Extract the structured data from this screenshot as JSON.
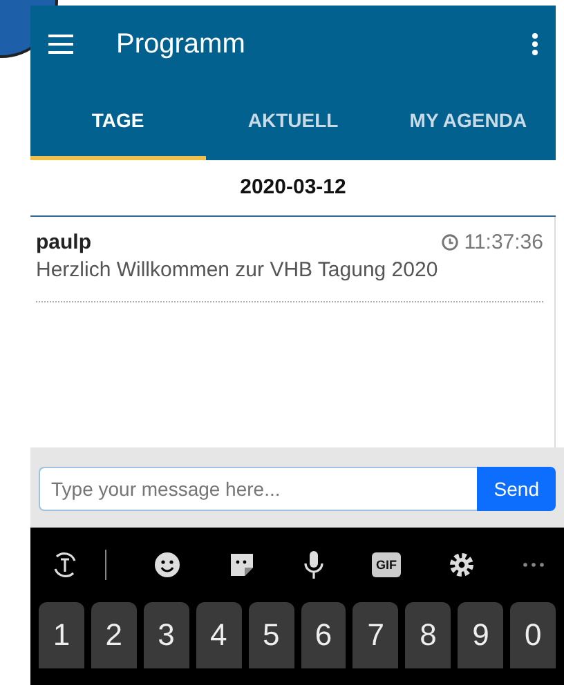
{
  "app_bar": {
    "title": "Programm"
  },
  "tabs": [
    {
      "label": "TAGE",
      "selected": true
    },
    {
      "label": "AKTUELL",
      "selected": false
    },
    {
      "label": "MY AGENDA",
      "selected": false
    }
  ],
  "date_header": "2020-03-12",
  "messages": [
    {
      "user": "paulp",
      "time": "11:37:36",
      "text": "Herzlich Willkommen zur VHB Tagung 2020"
    }
  ],
  "composer": {
    "placeholder": "Type your message here...",
    "send_label": "Send"
  },
  "keyboard": {
    "gif_label": "GIF",
    "number_keys": [
      "1",
      "2",
      "3",
      "4",
      "5",
      "6",
      "7",
      "8",
      "9",
      "0"
    ]
  }
}
